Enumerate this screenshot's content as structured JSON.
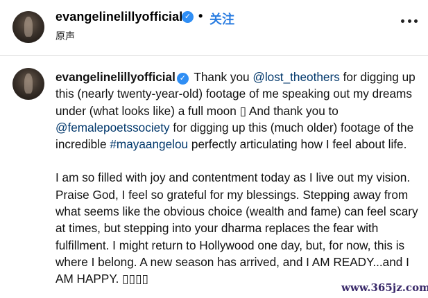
{
  "header": {
    "username": "evangelinelillyofficial",
    "verified_icon": "verified-badge-icon",
    "separator": "•",
    "follow_label": "关注",
    "subtitle": "原声",
    "more_icon": "more-horizontal-icon"
  },
  "post": {
    "username": "evangelinelillyofficial",
    "p1": {
      "t1": " Thank you ",
      "m1": "@lost_theothers",
      "t2": " for digging up this (nearly twenty-year-old) footage of me speaking out my dreams under (what looks like) a full moon ▯ And thank you to ",
      "m2": "@femalepoetssociety",
      "t3": " for digging up this (much older) footage of the incredible ",
      "h1": "#mayaangelou",
      "t4": " perfectly articulating how I feel about life."
    },
    "p2": "I am so filled with joy and contentment today as I live out my vision. Praise God, I feel so grateful for my blessings. Stepping away from what seems like the obvious choice (wealth and fame) can feel scary at times, but stepping into your dharma replaces the fear with fulfillment. I might return to Hollywood one day, but, for now, this is where I belong. A new season has arrived, and I AM READY...and I AM HAPPY. ▯▯▯▯"
  },
  "watermark": "www.365jz.com",
  "colors": {
    "follow": "#2a7de1",
    "mention": "#00376b",
    "verified": "#2f8ef4"
  }
}
